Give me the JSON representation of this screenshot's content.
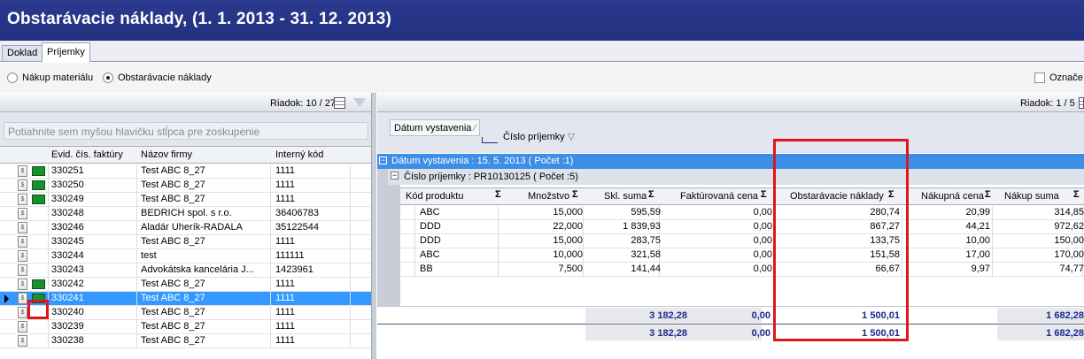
{
  "title": "Obstarávacie náklady,  (1. 1. 2013 - 31. 12. 2013)",
  "tabs": [
    {
      "label": "Doklad"
    },
    {
      "label": "Príjemky"
    }
  ],
  "radios": [
    {
      "label": "Nákup materiálu",
      "checked": false
    },
    {
      "label": "Obstarávacie náklady",
      "checked": true
    }
  ],
  "checkbox_label": "Označe",
  "left": {
    "riadok": "Riadok: 10 / 27",
    "group_hint": "Potiahnite sem myšou hlavičku stĺpca pre zoskupenie",
    "columns": [
      "Evid. čís. faktúry",
      "Názov firmy",
      "Interný kód"
    ],
    "rows": [
      {
        "evid": "330251",
        "firma": "Test ABC 8_27",
        "kod": "1111",
        "green": true
      },
      {
        "evid": "330250",
        "firma": "Test ABC 8_27",
        "kod": "1111",
        "green": true
      },
      {
        "evid": "330249",
        "firma": "Test ABC 8_27",
        "kod": "1111",
        "green": true
      },
      {
        "evid": "330248",
        "firma": "BEDRICH spol. s r.o.",
        "kod": "36406783",
        "green": false
      },
      {
        "evid": "330246",
        "firma": "Aladár Uherík-RADALA",
        "kod": "35122544",
        "green": false
      },
      {
        "evid": "330245",
        "firma": "Test ABC 8_27",
        "kod": "1111",
        "green": false
      },
      {
        "evid": "330244",
        "firma": "test",
        "kod": "111111",
        "green": false
      },
      {
        "evid": "330243",
        "firma": "Advokátska kancelária J...",
        "kod": "1423961",
        "green": false
      },
      {
        "evid": "330242",
        "firma": "Test ABC 8_27",
        "kod": "1111",
        "green": true
      },
      {
        "evid": "330241",
        "firma": "Test ABC 8_27",
        "kod": "1111",
        "green": true,
        "selected": true
      },
      {
        "evid": "330240",
        "firma": "Test ABC 8_27",
        "kod": "1111",
        "green": false
      },
      {
        "evid": "330239",
        "firma": "Test ABC 8_27",
        "kod": "1111",
        "green": false
      },
      {
        "evid": "330238",
        "firma": "Test ABC 8_27",
        "kod": "1111",
        "green": false
      }
    ]
  },
  "right": {
    "riadok": "Riadok: 1 / 5",
    "group_buttons": [
      "Dátum vystavenia",
      "Číslo príjemky"
    ],
    "group_row": "Dátum vystavenia : 15. 5. 2013 ( Počet :1)",
    "sub_group_row": "Číslo príjemky : PR10130125 ( Počet :5)",
    "columns": [
      "Kód produktu",
      "Množstvo",
      "Skl. suma",
      "Faktúrovaná cena",
      "Obstarávacie náklady",
      "Nákupná cena",
      "Nákup suma"
    ],
    "rows": [
      [
        "ABC",
        "15,000",
        "595,59",
        "0,00",
        "280,74",
        "20,99",
        "314,85"
      ],
      [
        "DDD",
        "22,000",
        "1 839,93",
        "0,00",
        "867,27",
        "44,21",
        "972,62"
      ],
      [
        "DDD",
        "15,000",
        "283,75",
        "0,00",
        "133,75",
        "10,00",
        "150,00"
      ],
      [
        "ABC",
        "10,000",
        "321,58",
        "0,00",
        "151,58",
        "17,00",
        "170,00"
      ],
      [
        "BB",
        "7,500",
        "141,44",
        "0,00",
        "66,67",
        "9,97",
        "74,77"
      ]
    ],
    "sum1": [
      "3 182,28",
      "0,00",
      "1 500,01",
      "1 682,28"
    ],
    "sum2": [
      "3 182,28",
      "0,00",
      "1 500,01",
      "1 682,28"
    ]
  },
  "colors": {
    "title_bar": "#223080",
    "selection": "#3399ff",
    "group_bar": "#3d8ee6",
    "highlight": "#e0141c",
    "sum_text": "#1a2a8c"
  }
}
